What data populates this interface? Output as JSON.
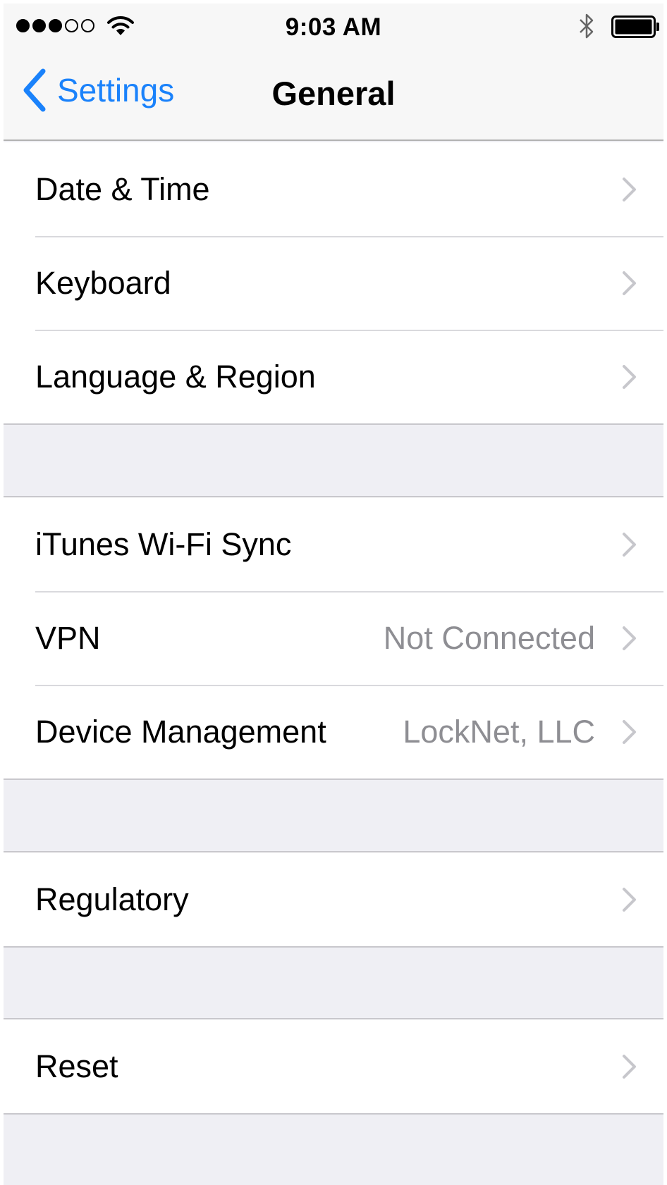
{
  "status_bar": {
    "signal_bars_filled": 3,
    "signal_bars_total": 5,
    "time": "9:03 AM",
    "icons": [
      "wifi-icon",
      "bluetooth-icon",
      "battery-icon"
    ]
  },
  "navbar": {
    "back_label": "Settings",
    "title": "General"
  },
  "groups": [
    {
      "rows": [
        {
          "label": "Date & Time",
          "value": ""
        },
        {
          "label": "Keyboard",
          "value": ""
        },
        {
          "label": "Language & Region",
          "value": ""
        }
      ]
    },
    {
      "rows": [
        {
          "label": "iTunes Wi-Fi Sync",
          "value": ""
        },
        {
          "label": "VPN",
          "value": "Not Connected"
        },
        {
          "label": "Device Management",
          "value": "LockNet, LLC"
        }
      ]
    },
    {
      "rows": [
        {
          "label": "Regulatory",
          "value": ""
        }
      ]
    },
    {
      "rows": [
        {
          "label": "Reset",
          "value": ""
        }
      ]
    }
  ],
  "colors": {
    "accent": "#1a82fb",
    "background": "#efeff4",
    "secondary_text": "#8e8e93"
  }
}
